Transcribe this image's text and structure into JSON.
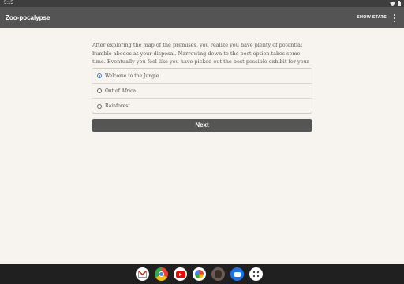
{
  "status_bar": {
    "time": "5:15"
  },
  "app_bar": {
    "title": "Zoo-pocalypse",
    "show_stats": "SHOW STATS"
  },
  "passage": "After exploring the map of the premises, you realize you have plenty of potential humble abodes at your disposal. Narrowing down to the best option takes some time. Eventually you feel like you have picked out the best possible exhibit for your post-apocalyptic habitat.",
  "choices": [
    {
      "label": "Welcome to the Jungle",
      "selected": true
    },
    {
      "label": "Out of Africa",
      "selected": false
    },
    {
      "label": "Rainforest",
      "selected": false
    }
  ],
  "next_label": "Next",
  "dock": [
    {
      "name": "gmail-icon"
    },
    {
      "name": "chrome-icon"
    },
    {
      "name": "youtube-icon"
    },
    {
      "name": "photos-icon"
    },
    {
      "name": "app-avatar-icon"
    },
    {
      "name": "messages-icon"
    },
    {
      "name": "app-launcher-icon"
    }
  ],
  "colors": {
    "app_bar": "#545454",
    "background": "#f7f4ef",
    "button": "#555555",
    "radio_accent": "#3f7ad3"
  }
}
